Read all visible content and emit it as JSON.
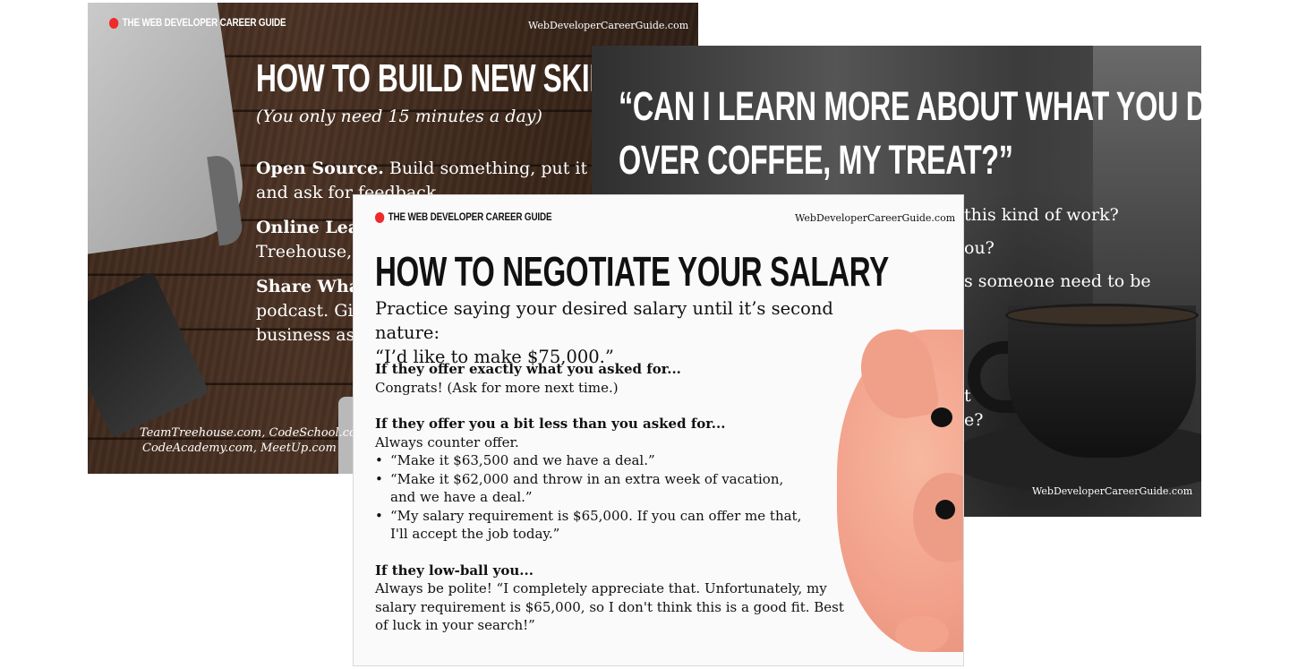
{
  "brand": "THE WEB DEVELOPER CAREER GUIDE",
  "site": "WebDeveloperCareerGuide.com",
  "colors": {
    "brand_dot": "#ee2a2a"
  },
  "skills_card": {
    "title": "HOW TO BUILD NEW SKILLS",
    "subtitle": "(You only need 15 minutes a day)",
    "items": [
      {
        "head": "Open Source.",
        "text": "Build something, put it on",
        "line2": "and ask for feedback."
      },
      {
        "head": "Online Lea",
        "text": "",
        "line2": "Treehouse,"
      },
      {
        "head": "Share Wha",
        "text": "",
        "line2": "podcast. Giv",
        "line3": "business ass"
      }
    ],
    "sources_line1": "TeamTreehouse.com, CodeSchool.com,",
    "sources_line2": "CodeAcademy.com, MeetUp.com"
  },
  "coffee_card": {
    "title_line1": "“CAN I LEARN MORE ABOUT WHAT YOU DO",
    "title_line2": "OVER COFFEE, MY TREAT?”",
    "q1": "this kind of work?",
    "q2": "ou?",
    "q3": "s someone need to be",
    "q4": "t",
    "q5": "e?"
  },
  "salary_card": {
    "title": "HOW TO NEGOTIATE YOUR SALARY",
    "intro_line1": "Practice saying your desired salary until it’s second nature:",
    "intro_line2": "“I’d like to make $75,000.”",
    "s1_head": "If they offer exactly what you asked for...",
    "s1_text": "Congrats! (Ask for more next time.)",
    "s2_head": "If they offer you a bit less than you asked for...",
    "s2_text": "Always counter offer.",
    "s2_bullets": [
      "“Make it $63,500 and we have a deal.”",
      "“Make it $62,000 and throw in an extra week of vacation, and we have a deal.”",
      "“My salary requirement is $65,000. If you can offer me that, I'll accept the job today.”"
    ],
    "s3_head": "If they low-ball you...",
    "s3_text": "Always be polite! “I completely appreciate that. Unfortunately, my salary requirement is $65,000, so I don't think this is a good fit. Best of luck in your search!”"
  }
}
